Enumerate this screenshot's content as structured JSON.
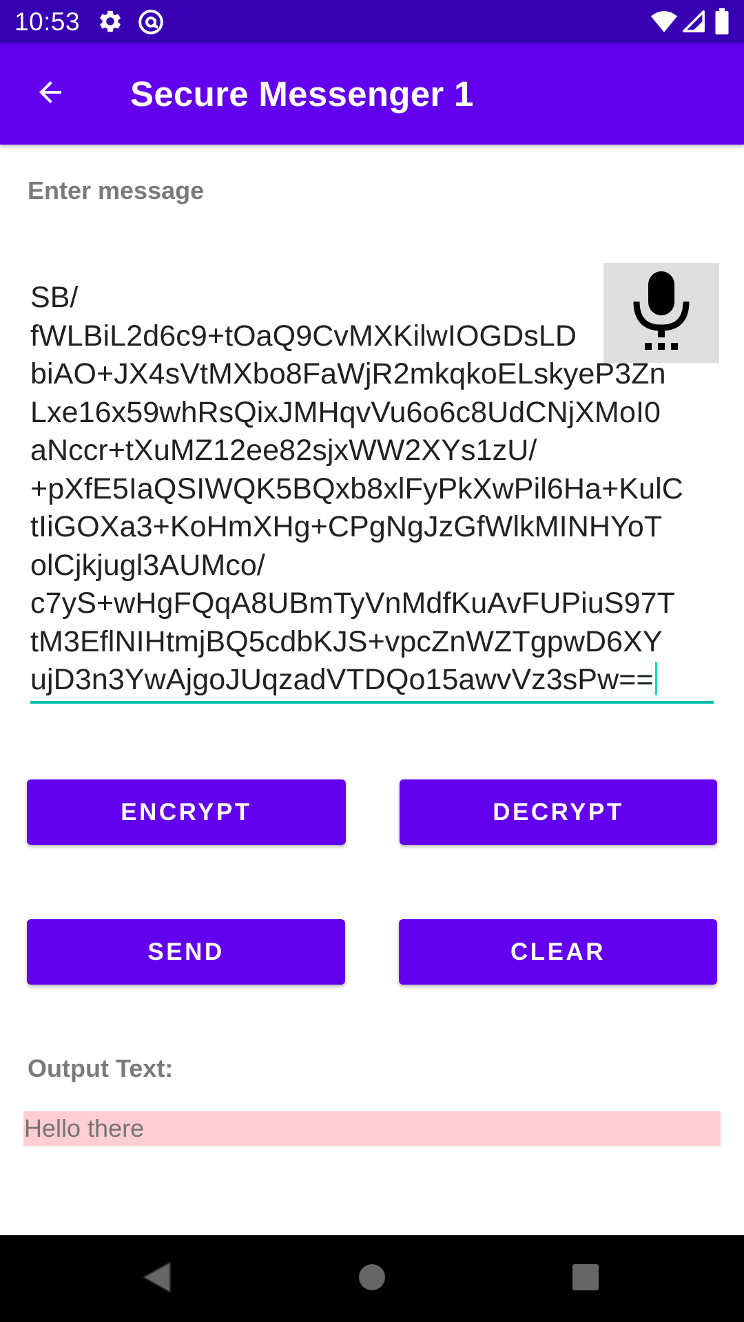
{
  "status_bar": {
    "time": "10:53",
    "icons": [
      "gear-icon",
      "at-sign-icon",
      "wifi-icon",
      "signal-icon",
      "battery-icon"
    ]
  },
  "app_bar": {
    "title": "Secure Messenger 1",
    "back_icon": "arrow-back-icon"
  },
  "message": {
    "label": "Enter message",
    "value_lines": [
      "SB/",
      "fWLBiL2d6c9+tOaQ9CvMXKilwIOGDsLD",
      "biAO+JX4sVtMXbo8FaWjR2mkqkoELskyeP3Zn",
      "Lxe16x59whRsQixJMHqvVu6o6c8UdCNjXMoI0",
      "aNccr+tXuMZ12ee82sjxWW2XYs1zU/",
      "+pXfE5IaQSIWQK5BQxb8xlFyPkXwPil6Ha+KulC",
      "tIiGOXa3+KoHmXHg+CPgNgJzGfWlkMINHYoT",
      "olCjkjugl3AUMco/",
      "c7yS+wHgFQqA8UBmTyVnMdfKuAvFUPiuS97T",
      "tM3EflNIHtmjBQ5cdbKJS+vpcZnWZTgpwD6XY",
      "ujD3n3YwAjgoJUqzadVTDQo15awvVz3sPw=="
    ],
    "mic_icon": "microphone-icon"
  },
  "buttons": {
    "encrypt": "ENCRYPT",
    "decrypt": "DECRYPT",
    "send": "SEND",
    "clear": "CLEAR"
  },
  "output": {
    "label": "Output Text:",
    "value": "Hello there"
  },
  "nav_bar": {
    "icons": [
      "back-triangle-icon",
      "home-circle-icon",
      "recents-square-icon"
    ]
  },
  "colors": {
    "status_bar": "#3700b3",
    "primary": "#6200ee",
    "accent": "#03dac5",
    "output_background": "#ffcdd2"
  }
}
